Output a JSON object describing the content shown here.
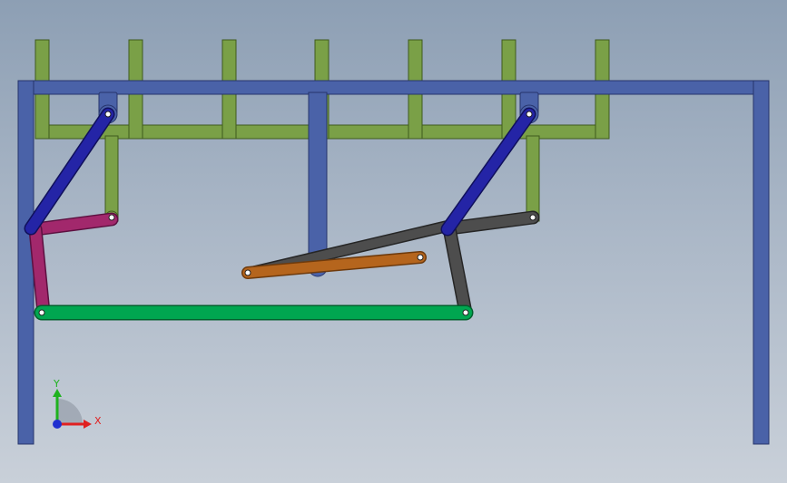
{
  "viewport": {
    "background_top": "#8d9fb4",
    "background_bottom": "#c9d0d9"
  },
  "colors": {
    "frame_blue": "#4a62a8",
    "frame_outline": "#26346b",
    "green_frame": "#7aa047",
    "green_outline": "#3f5a1e",
    "dark_blue_link": "#2424a6",
    "magenta_link": "#a2286c",
    "coupler_green": "#00a650",
    "grey_link": "#4d4d4d",
    "orange_link": "#b5651d"
  },
  "triad": {
    "x_label": "X",
    "y_label": "Y",
    "x_color": "#e02020",
    "y_color": "#1eb21e",
    "z_color": "#2030d0"
  }
}
